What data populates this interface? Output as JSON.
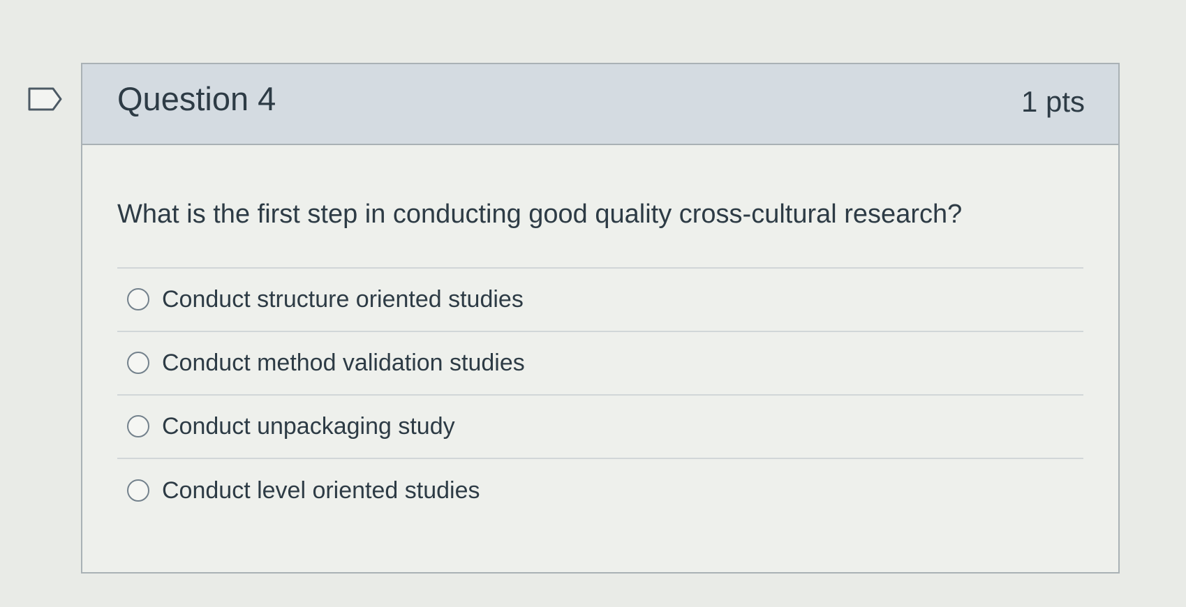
{
  "question": {
    "title": "Question 4",
    "points": "1 pts",
    "text": "What is the first step in conducting good quality cross-cultural research?",
    "answers": [
      {
        "label": "Conduct structure oriented studies",
        "selected": false
      },
      {
        "label": "Conduct method validation studies",
        "selected": false
      },
      {
        "label": "Conduct unpackaging study",
        "selected": false
      },
      {
        "label": "Conduct level oriented studies",
        "selected": false
      }
    ]
  },
  "icons": {
    "flag": "flag-question-icon"
  },
  "colors": {
    "header_bg": "#d4dbe1",
    "text": "#2d3b45",
    "border": "#a9b1b5"
  }
}
